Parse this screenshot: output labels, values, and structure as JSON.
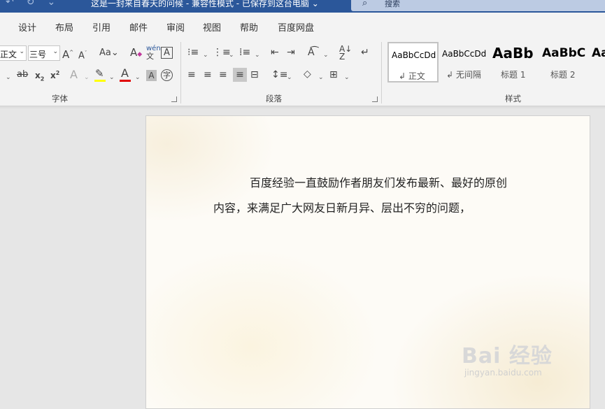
{
  "titlebar": {
    "document_title": "这是一封来自春天的问候  -  兼容性模式  -  已保存到这台电脑  ⌄",
    "search_label": "搜索"
  },
  "tabs": [
    "设计",
    "布局",
    "引用",
    "邮件",
    "审阅",
    "视图",
    "帮助",
    "百度网盘"
  ],
  "font_group": {
    "style_combo_value": "正文",
    "size_combo_value": "三号",
    "label": "字体",
    "highlight_color": "#ffff00",
    "font_color": "#e00000"
  },
  "paragraph_group": {
    "label": "段落"
  },
  "styles_group": {
    "label": "样式",
    "items": [
      {
        "preview": "AaBbCcDd",
        "name": "↲ 正文"
      },
      {
        "preview": "AaBbCcDd",
        "name": "↲ 无间隔"
      },
      {
        "preview": "AaBb",
        "name": "标题 1"
      },
      {
        "preview": "AaBbC",
        "name": "标题 2"
      },
      {
        "preview": "Aa",
        "name": ""
      }
    ]
  },
  "document": {
    "line1": "百度经验一直鼓励作者朋友们发布最新、最好的原创",
    "line2": "内容，来满足广大网友日新月异、层出不穷的问题，"
  },
  "watermark": {
    "logo_text": "Bai  经验",
    "sub_text": "jingyan.baidu.com"
  }
}
